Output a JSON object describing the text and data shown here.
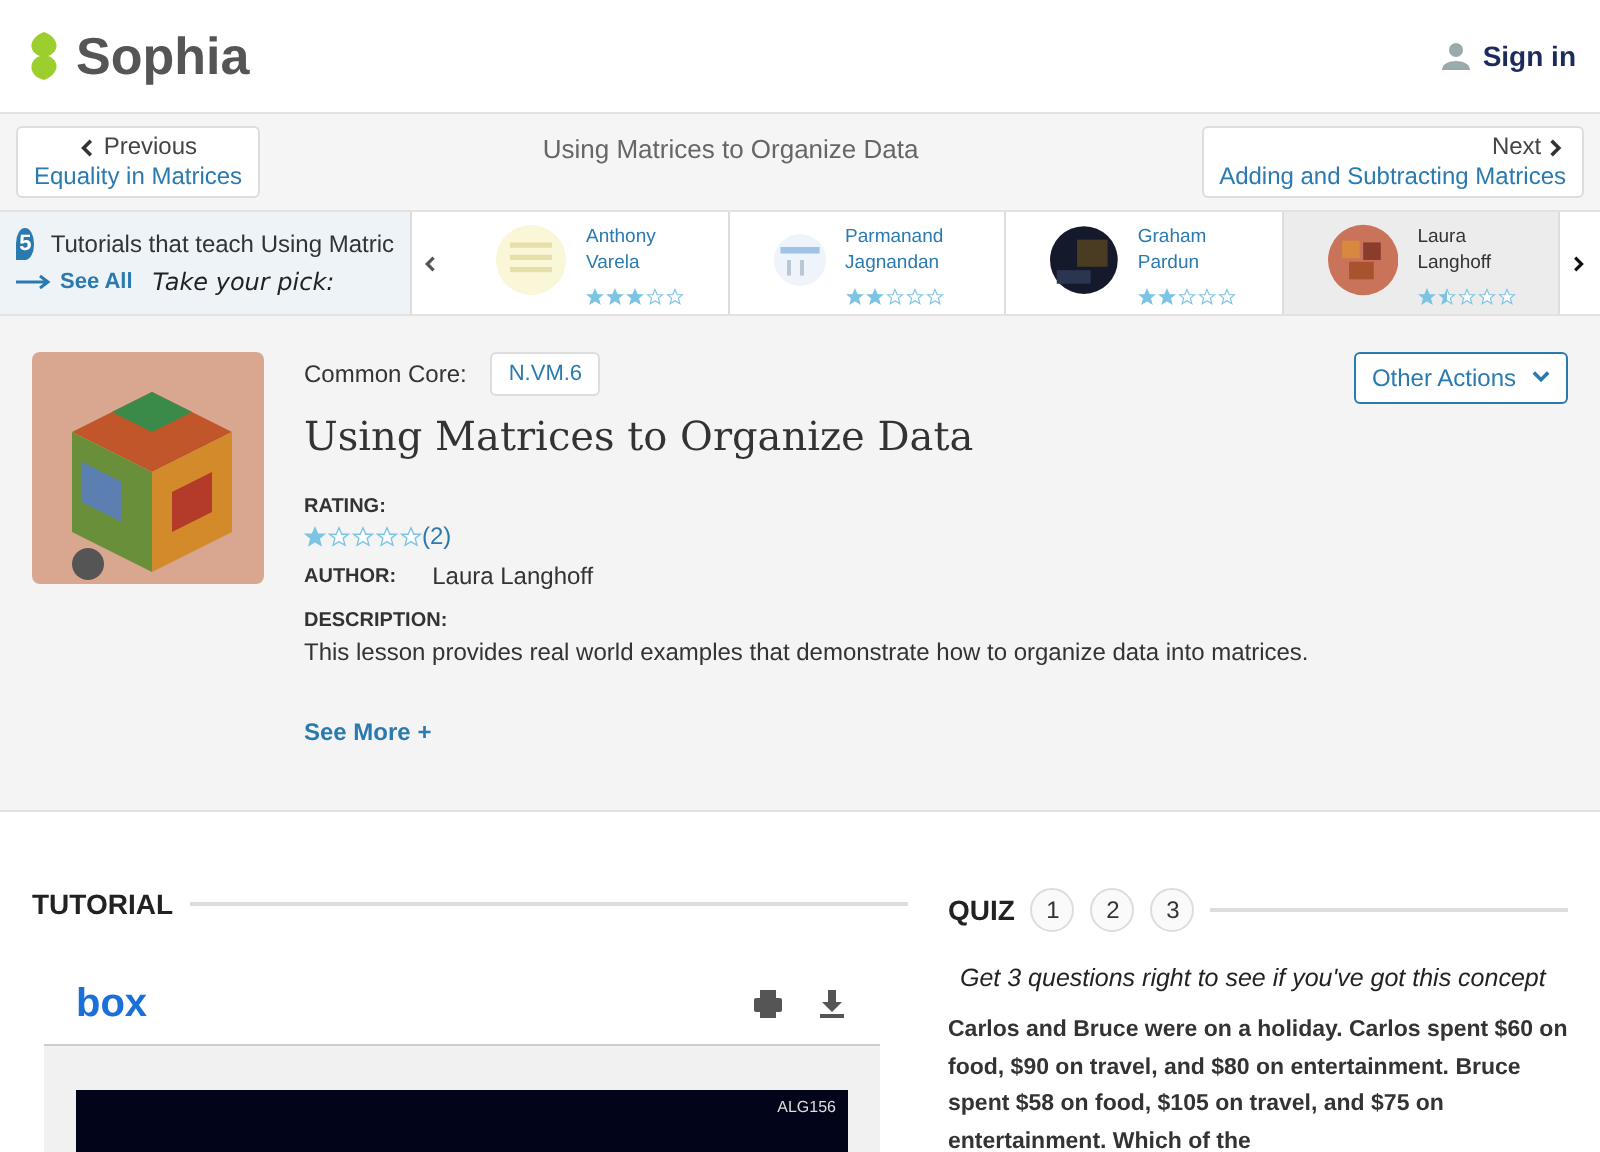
{
  "header": {
    "logo": "Sophia",
    "sign_in": "Sign in"
  },
  "nav": {
    "previous": {
      "label": "Previous",
      "title": "Equality in Matrices"
    },
    "current": "Using Matrices to Organize Data",
    "next": {
      "label": "Next",
      "title": "Adding and Subtracting Matrices"
    }
  },
  "carousel": {
    "count": "5",
    "heading": "Tutorials that teach Using Matric",
    "see_all": "See All",
    "tagline": "Take your pick:",
    "items": [
      {
        "author": "Anthony Varela",
        "stars": 3,
        "selected": false
      },
      {
        "author": "Parmanand Jagnandan",
        "stars": 2,
        "selected": false
      },
      {
        "author": "Graham Pardun",
        "stars": 2,
        "selected": false
      },
      {
        "author": "Laura Langhoff",
        "stars": 1.5,
        "selected": true
      }
    ]
  },
  "lesson": {
    "common_core_label": "Common Core:",
    "standard": "N.VM.6",
    "title": "Using Matrices to Organize Data",
    "other_actions": "Other Actions",
    "rating_label": "RATING:",
    "stars": 1,
    "rating_count": "(2)",
    "author_label": "AUTHOR:",
    "author": "Laura Langhoff",
    "description_label": "DESCRIPTION:",
    "description": "This lesson provides real world examples that demonstrate how to organize data into matrices.",
    "see_more": "See More +"
  },
  "tutorial": {
    "heading": "TUTORIAL",
    "viewer_logo": "box",
    "slide_label": "ALG156"
  },
  "quiz": {
    "heading": "QUIZ",
    "questions": [
      "1",
      "2",
      "3"
    ],
    "tagline": "Get 3 questions right to see if you've got this concept",
    "question_text": "Carlos and Bruce were on a holiday. Carlos spent $60 on food, $90 on travel, and $80 on entertainment. Bruce spent $58 on food, $105 on travel, and $75 on entertainment. Which of the"
  }
}
